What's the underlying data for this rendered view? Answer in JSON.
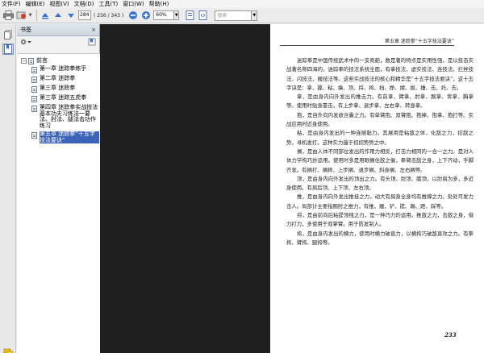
{
  "menu": [
    "文件(F)",
    "编辑(E)",
    "视图(V)",
    "文档(D)",
    "工具(T)",
    "窗口(W)",
    "帮助(H)"
  ],
  "toolbar": {
    "page_value": "284",
    "page_count": "( 256 / 343 )",
    "zoom_value": "60%",
    "search_placeholder": "搜索"
  },
  "bookmarks": {
    "title": "书签",
    "root_label": "前言",
    "items": [
      {
        "label": "第一章 迷踪拳练乎"
      },
      {
        "label": "第二章 迷踪拳"
      },
      {
        "label": "第三章 迷踪拳"
      },
      {
        "label": "第三章 迷踪五虎拳"
      },
      {
        "label": "第四章 迷踪拳实战技法基本功夫习练法一要法、肘法、腿法击功作练习"
      },
      {
        "label": "第五章 迷踪拳“十五字技法要诀”"
      }
    ],
    "selected_index": 5
  },
  "page": {
    "running_head": "第五章  迷踪拳“十五字技法要诀”",
    "paragraphs": [
      "迷踪拳是中国传统武术中的一支奇葩，数是著的特点是实用性强，是以技击实战著名称四海的。迷踪拳的技法系统全面，有拿技法、虚实技法、连技法、拦挫技法、闪技法、搬技法等。这些实战技法的核心和精华是“十五字技法要诀”，这十五字诀是：拿、搡、粘、擒、顶、捋、挎、挡、挣、揉、拔、捶、击、托、去。",
      "拿，是由身内向外发出的推击力。有前拿、臂拿、肘拿、腕拿、背拿、胸拿等。使用时贴身靠击，有上步拿、退步拿、左右拿、转身拿。",
      "抱，是自外向内发收含囊之力。有单臂抱、双臂抱、抱捧、抱拿、抱打等。实战应用时近身使用。",
      "粘，是由身内发出的一种连随黏力。其展用是粘敌之体，化敌之力，控敌之势，寻机发打。这种实力蕴于招招势势之中。",
      "搁，是由人体不同部位发出的作用力相反，打击力相同的一合一之力。是对人体力学构巧妙运用。使用时多是用眼搁住敌之催，拳臂击敌之身，上下齐动，手脚齐发。有搁打、搁摔、上步搁、退步搁、斜身搁、左右搁等。",
      "顶，是由身内向外发出的顶出之力。有头顶、肘顶、膝顶，以肘肩为多，多近身使用。有肩后顶、上下顶、左右顶。",
      "推，是由身内向外发出推挂之力，动大有探身全身均有推撑之力。处处可发力击人。局部计主要指腕肘之推力，有推、履、铲、搓、踢、蹬、踩等。",
      "捋，是由前向后粘提领拽之力，是一种巧力的运用。推敌之力，击敌之身，借力打力，多使用于双掌臂。用于防发制人。",
      "挎，是由身内发出的横力，使用时横力破直力，以横挎巧破敌直攻之力。有拳挎、臂挎、腿挎等。"
    ],
    "page_number": "233"
  }
}
